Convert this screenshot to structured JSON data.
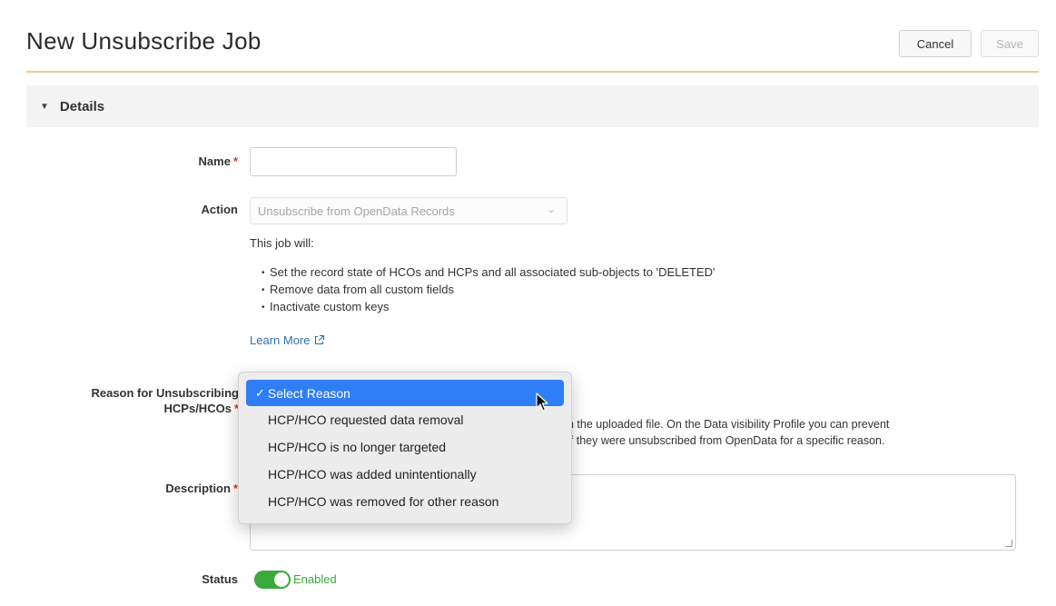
{
  "header": {
    "title": "New Unsubscribe Job",
    "cancel_label": "Cancel",
    "save_label": "Save"
  },
  "section": {
    "title": "Details",
    "caret": "▼"
  },
  "form": {
    "name_label": "Name",
    "name_value": "",
    "action_label": "Action",
    "action_value": "Unsubscribe from OpenData Records",
    "job_intro": "This job will:",
    "job_bullets": [
      "Set the record state of HCOs and HCPs and all associated sub-objects to 'DELETED'",
      "Remove data from all custom fields",
      "Inactivate custom keys"
    ],
    "learn_more": "Learn More",
    "reason_label_line1": "Reason for Unsubscribing",
    "reason_label_line2": "HCPs/HCOs",
    "reason_help_line1": "n the uploaded file. On the Data visibility Profile you can prevent",
    "reason_help_line2": "if they were unsubscribed from OpenData for a specific reason.",
    "description_label": "Description",
    "description_value": "",
    "status_label": "Status",
    "status_value": "Enabled",
    "required_marker": "*"
  },
  "reason_dropdown": {
    "selected": "Select Reason",
    "check": "✓",
    "options": [
      "HCP/HCO requested data removal",
      "HCP/HCO is no longer targeted",
      "HCP/HCO was added unintentionally",
      "HCP/HCO was removed for other reason"
    ]
  },
  "colors": {
    "accent_rule": "#f0c999",
    "required": "#d9362b",
    "link": "#2f6fb0",
    "toggle_on": "#3aa83a",
    "dropdown_highlight": "#2f7ef5"
  },
  "icons": {
    "section_caret": "caret-down-icon",
    "action_dropdown": "chevron-down-icon",
    "learn_more": "external-link-icon",
    "selected_option": "checkmark-icon",
    "pointer": "mouse-cursor-icon"
  }
}
